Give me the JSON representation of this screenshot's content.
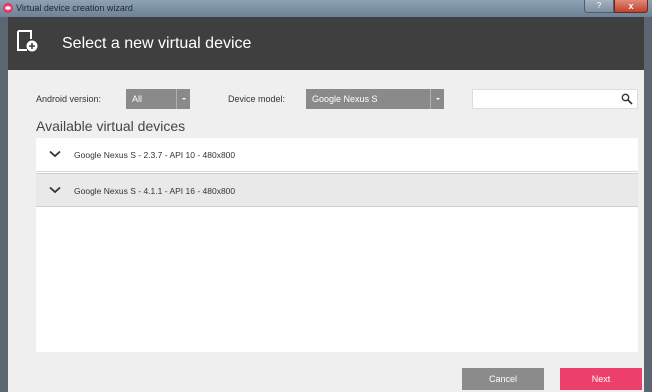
{
  "window": {
    "title": "Virtual device creation wizard",
    "help_label": "?",
    "close_label": "x"
  },
  "header": {
    "title": "Select a new virtual device",
    "icon": "new-device-icon"
  },
  "filters": {
    "android_version_label": "Android version:",
    "android_version_value": "All",
    "device_model_label": "Device model:",
    "device_model_value": "Google Nexus S",
    "search_value": ""
  },
  "devices": {
    "section_title": "Available virtual devices",
    "items": [
      {
        "label": "Google Nexus S - 2.3.7 - API 10 - 480x800",
        "selected": false
      },
      {
        "label": "Google Nexus S - 4.1.1 - API 16 - 480x800",
        "selected": true
      }
    ]
  },
  "footer": {
    "cancel_label": "Cancel",
    "next_label": "Next"
  },
  "colors": {
    "accent": "#ec3f6b",
    "header_bg": "#3f3f3f",
    "dropdown_bg": "#8a8a8a",
    "cancel_bg": "#8b8b8b"
  }
}
